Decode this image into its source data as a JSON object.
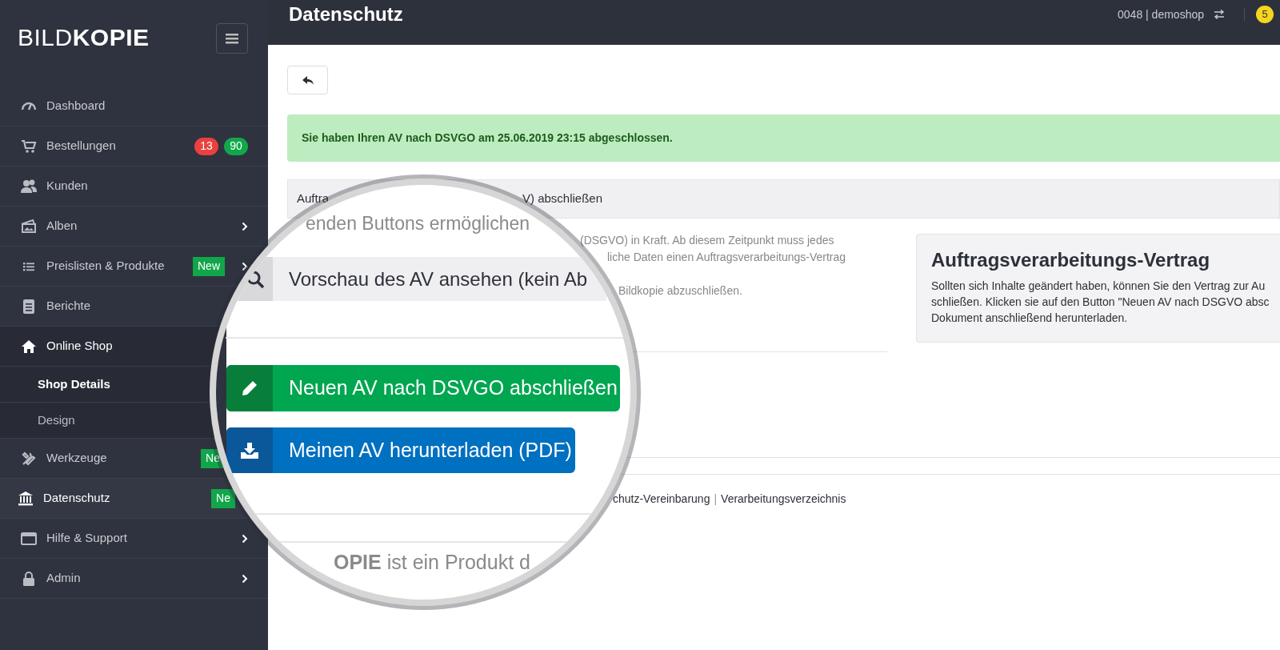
{
  "sidebar": {
    "logo": {
      "light": "BILD",
      "bold": "KOPIE"
    },
    "items": [
      {
        "kind": "item",
        "label": "Dashboard",
        "selected": false,
        "chevron": false
      },
      {
        "kind": "item",
        "label": "Bestellungen",
        "selected": false,
        "chevron": false,
        "counts": [
          {
            "text": "13",
            "color": "#e9413e"
          },
          {
            "text": "90",
            "color": "#11a84b"
          }
        ]
      },
      {
        "kind": "item",
        "label": "Kunden",
        "selected": false,
        "chevron": false
      },
      {
        "kind": "item",
        "label": "Alben",
        "selected": false,
        "chevron": true
      },
      {
        "kind": "item",
        "label": "Preislisten & Produkte",
        "selected": false,
        "chevron": true,
        "badge": "New"
      },
      {
        "kind": "item",
        "label": "Berichte",
        "selected": false,
        "chevron": false
      },
      {
        "kind": "group",
        "label": "Online Shop",
        "selected": false,
        "expanded": true,
        "children": [
          {
            "label": "Shop Details",
            "selected": true
          },
          {
            "label": "Design",
            "selected": false
          }
        ]
      },
      {
        "kind": "item",
        "label": "Werkzeuge",
        "selected": false,
        "chevron": false,
        "badge": "Ne"
      },
      {
        "kind": "item",
        "label": "Datenschutz",
        "selected": true,
        "chevron": false,
        "badge": "Ne"
      },
      {
        "kind": "item",
        "label": "Hilfe & Support",
        "selected": false,
        "chevron": true
      },
      {
        "kind": "item",
        "label": "Admin",
        "selected": false,
        "chevron": true
      }
    ]
  },
  "header": {
    "title": "Datenschutz",
    "account": "0048 | demoshop",
    "notifications": "5"
  },
  "alert": "Sie haben Ihren AV nach DSVGO am 25.06.2019 23:15 abgeschlossen.",
  "panel_heading": [
    "Auftra",
    "V) abschließen"
  ],
  "paragraph_lines": [
    "(DSGVO) in Kraft. Ab diesem Zeitpunkt muss jedes",
    "liche Daten einen Auftragsverarbeitungs-Vertrag",
    "Bildkopie abzuschließen."
  ],
  "info_box": {
    "title": "Auftragsverarbeitungs-Vertrag",
    "lines": [
      "Sollten sich Inhalte geändert haben, können Sie den Vertrag zur Au",
      "schließen. Klicken sie auf den Button \"Neuen AV nach DSGVO absc",
      "Dokument anschließend herunterladen."
    ]
  },
  "footer_links": [
    "chutz-Vereinbarung",
    "|",
    "Verarbeitungsverzeichnis"
  ],
  "magnifier": {
    "intro": "enden Buttons ermöglichen",
    "buttons": [
      {
        "kind": "preview",
        "label": "Vorschau des AV ansehen (kein Ab"
      },
      {
        "kind": "sign",
        "label": "Neuen AV nach DSVGO abschließen"
      },
      {
        "kind": "download",
        "label": "Meinen AV herunterladen (PDF)"
      }
    ],
    "footer": "**OPIE** ist ein Produkt d"
  }
}
